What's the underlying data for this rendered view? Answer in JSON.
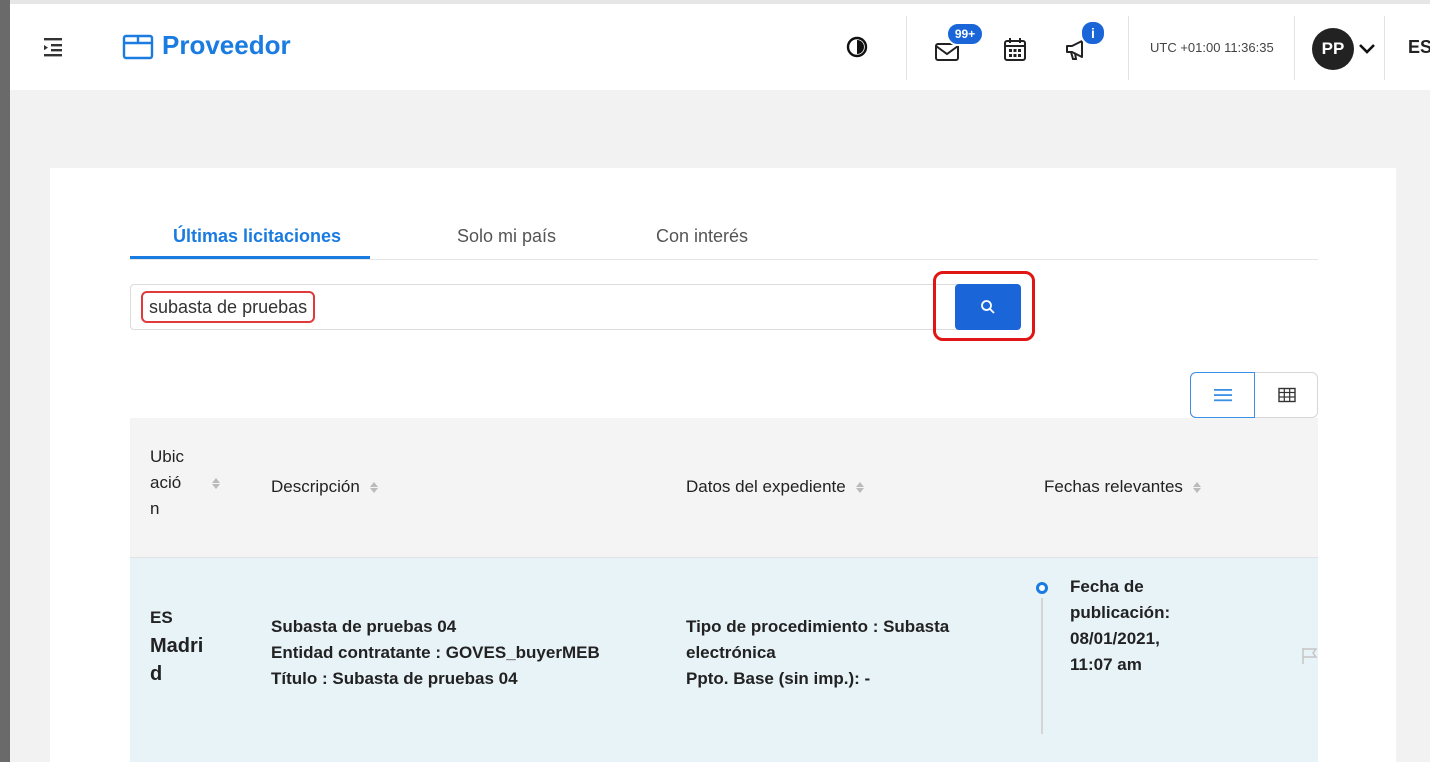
{
  "header": {
    "brand": "Proveedor",
    "messages_badge": "99+",
    "alerts_badge": "i",
    "clock": "UTC +01:00 11:36:35",
    "avatar_initials": "PP",
    "language": "ES",
    "icons": [
      "menu-collapse-icon",
      "box-icon",
      "contrast-icon",
      "mail-icon",
      "calendar-icon",
      "megaphone-icon",
      "chevron-down-icon"
    ]
  },
  "tabs": [
    {
      "label": "Últimas licitaciones",
      "active": true
    },
    {
      "label": "Solo mi país",
      "active": false
    },
    {
      "label": "Con interés",
      "active": false
    }
  ],
  "search": {
    "value": "subasta de pruebas",
    "button_icon": "search-icon"
  },
  "view_toggle": {
    "active": "list",
    "icons": [
      "list-view-icon",
      "grid-view-icon"
    ]
  },
  "table": {
    "columns": [
      "Ubic\nació\nn",
      "Descripción",
      "Datos del expediente",
      "Fechas relevantes"
    ],
    "rows": [
      {
        "country": "ES",
        "city": "Madrid",
        "description_lines": [
          "Subasta de pruebas 04",
          "Entidad contratante : GOVES_buyerMEB",
          "Título : Subasta de pruebas 04"
        ],
        "expediente_lines": [
          "Tipo de procedimiento : Subasta",
          "electrónica",
          "Ppto. Base (sin imp.): -"
        ],
        "fecha_lines": [
          "Fecha de",
          "publicación:",
          "08/01/2021,",
          "11:07 am"
        ]
      }
    ]
  },
  "colors": {
    "primary": "#1a7be0",
    "button": "#1a66d8",
    "highlight": "#e01515",
    "row_bg": "#e8f3f8"
  }
}
